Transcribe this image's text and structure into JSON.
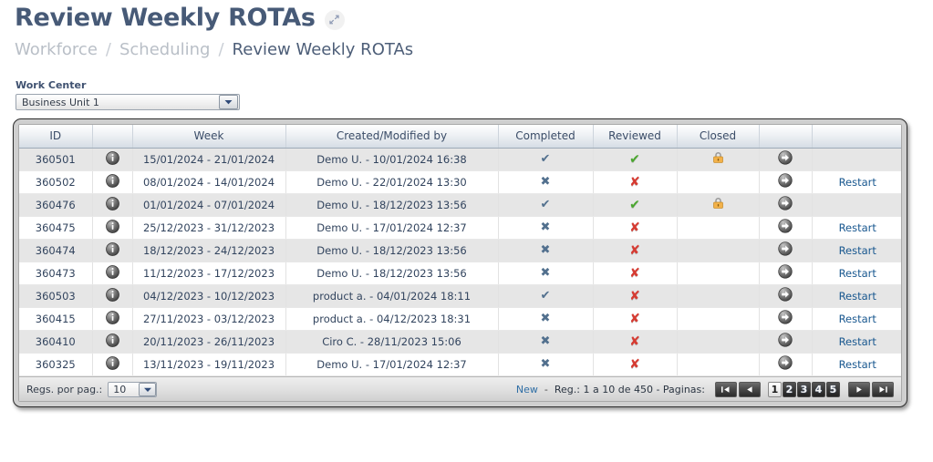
{
  "header": {
    "title": "Review Weekly ROTAs",
    "expand_icon": "expand-diagonal-icon",
    "breadcrumb": [
      "Workforce",
      "Scheduling",
      "Review Weekly ROTAs"
    ],
    "breadcrumb_separator": "/"
  },
  "work_center": {
    "label": "Work Center",
    "selected": "Business Unit 1",
    "arrow_icon": "chevron-down-icon"
  },
  "table": {
    "columns": [
      "ID",
      "",
      "Week",
      "Created/Modified by",
      "Completed",
      "Reviewed",
      "Closed",
      "",
      ""
    ],
    "icons": {
      "info": "info-icon",
      "go": "arrow-right-circle-icon",
      "closed": "padlock-icon",
      "check": "check-icon",
      "cross": "cross-icon"
    },
    "restart_label": "Restart",
    "rows": [
      {
        "id": "360501",
        "week": "15/01/2024 - 21/01/2024",
        "by": "Demo U. - 10/01/2024 16:38",
        "completed": "check",
        "reviewed": "check",
        "closed": "lock",
        "restart": ""
      },
      {
        "id": "360502",
        "week": "08/01/2024 - 14/01/2024",
        "by": "Demo U. - 22/01/2024 13:30",
        "completed": "cross",
        "reviewed": "cross",
        "closed": "",
        "restart": "Restart"
      },
      {
        "id": "360476",
        "week": "01/01/2024 - 07/01/2024",
        "by": "Demo U. - 18/12/2023 13:56",
        "completed": "check",
        "reviewed": "check",
        "closed": "lock",
        "restart": ""
      },
      {
        "id": "360475",
        "week": "25/12/2023 - 31/12/2023",
        "by": "Demo U. - 17/01/2024 12:37",
        "completed": "cross",
        "reviewed": "cross",
        "closed": "",
        "restart": "Restart"
      },
      {
        "id": "360474",
        "week": "18/12/2023 - 24/12/2023",
        "by": "Demo U. - 18/12/2023 13:56",
        "completed": "cross",
        "reviewed": "cross",
        "closed": "",
        "restart": "Restart"
      },
      {
        "id": "360473",
        "week": "11/12/2023 - 17/12/2023",
        "by": "Demo U. - 18/12/2023 13:56",
        "completed": "cross",
        "reviewed": "cross",
        "closed": "",
        "restart": "Restart"
      },
      {
        "id": "360503",
        "week": "04/12/2023 - 10/12/2023",
        "by": "product a. - 04/01/2024 18:11",
        "completed": "check",
        "reviewed": "cross",
        "closed": "",
        "restart": "Restart"
      },
      {
        "id": "360415",
        "week": "27/11/2023 - 03/12/2023",
        "by": "product a. - 04/12/2023 18:31",
        "completed": "cross",
        "reviewed": "cross",
        "closed": "",
        "restart": "Restart"
      },
      {
        "id": "360410",
        "week": "20/11/2023 - 26/11/2023",
        "by": "Ciro C. - 28/11/2023 15:06",
        "completed": "cross",
        "reviewed": "cross",
        "closed": "",
        "restart": "Restart"
      },
      {
        "id": "360325",
        "week": "13/11/2023 - 19/11/2023",
        "by": "Demo U. - 17/01/2024 12:37",
        "completed": "cross",
        "reviewed": "cross",
        "closed": "",
        "restart": "Restart"
      }
    ]
  },
  "footer": {
    "regs_label": "Regs. por pag.:",
    "regs_value": "10",
    "new_label": "New",
    "dash": "-",
    "record_info": "Reg.: 1 a 10 de 450 - Paginas:",
    "pages": [
      "1",
      "2",
      "3",
      "4",
      "5"
    ],
    "active_page": "1",
    "nav": {
      "first": "first-page-icon",
      "prev": "prev-page-icon",
      "next": "next-page-icon",
      "last": "last-page-icon"
    }
  },
  "colors": {
    "title": "#475a77",
    "breadcrumb_muted": "#b9bfc7",
    "link": "#18578f",
    "check_green": "#4aa72e",
    "cross_red": "#d63b32",
    "mark_slate": "#52708e",
    "lock_orange": "#f0a93c"
  }
}
